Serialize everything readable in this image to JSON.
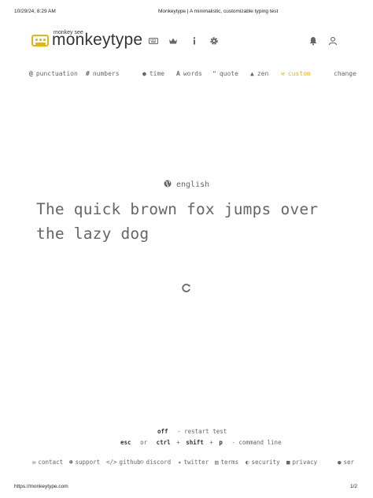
{
  "print_header": {
    "datetime": "10/29/24, 8:29 AM",
    "page_title": "Monkeytype | A minimalistic, customizable typing test"
  },
  "print_footer": {
    "url": "https://monkeytype.com",
    "page_count": "1/2"
  },
  "logo": {
    "tagline": "monkey see",
    "name": "monkeytype"
  },
  "nav_icons": [
    "keyboard-icon",
    "crown-icon",
    "info-icon",
    "gear-icon",
    "bell-icon",
    "user-icon"
  ],
  "config_bar": {
    "punctuation": "punctuation",
    "numbers": "numbers",
    "time": "time",
    "words": "words",
    "quote": "quote",
    "zen": "zen",
    "custom": "custom",
    "change": "change",
    "active_mode": "custom"
  },
  "test": {
    "language": "english",
    "text": "The quick brown fox jumps over the lazy dog"
  },
  "hints": {
    "line1_key": "off",
    "line1_text": "- restart test",
    "line2_key1": "esc",
    "line2_or": "or",
    "line2_key2": "ctrl",
    "line2_plus1": "+",
    "line2_key3": "shift",
    "line2_plus2": "+",
    "line2_key4": "p",
    "line2_text": "- command line"
  },
  "footer_links": {
    "contact": "contact",
    "support": "support",
    "github": "github",
    "discord": "discord",
    "twitter": "twitter",
    "terms": "terms",
    "security": "security",
    "privacy": "privacy",
    "theme": "ser"
  },
  "colors": {
    "accent": "#e2b714",
    "text_dim": "#646669",
    "text_main": "#323437",
    "background": "#ffffff"
  }
}
